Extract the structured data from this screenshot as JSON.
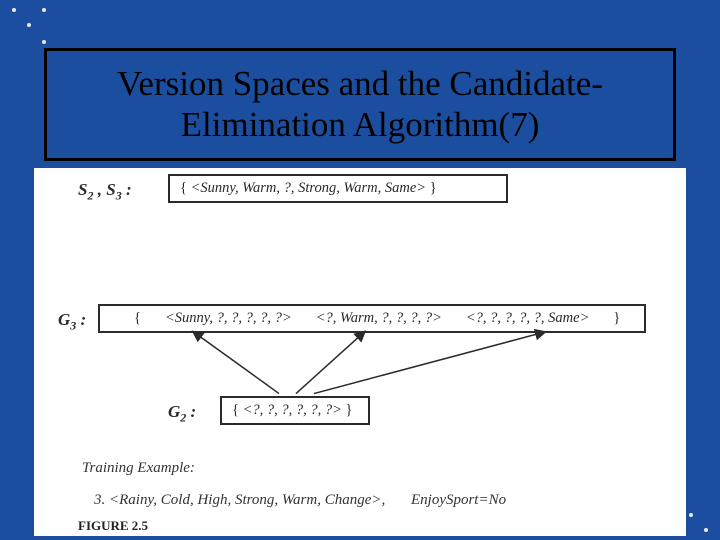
{
  "title": "Version Spaces and the Candidate-Elimination Algorithm(7)",
  "labels": {
    "s2s3_html": "S<span class='sub'>2</span> , S<span class='sub'>3</span> :",
    "g3_html": "G<span class='sub'>3</span> :",
    "g2_html": "G<span class='sub'>2</span> :"
  },
  "boxes": {
    "s": "<Sunny, Warm, ?, Strong, Warm, Same>",
    "g3": {
      "h1": "<Sunny, ?, ?, ?, ?, ?>",
      "h2": "<?, Warm, ?, ?, ?, ?>",
      "h3": "<?, ?, ?, ?, ?, Same>"
    },
    "g2": "<?, ?, ?, ?, ?, ?>"
  },
  "training": {
    "heading": "Training Example:",
    "index": "3.",
    "instance": "<Rainy, Cold, High, Strong, Warm, Change>,",
    "answer": "EnjoySport=No"
  },
  "figure_caption": "FIGURE 2.5"
}
